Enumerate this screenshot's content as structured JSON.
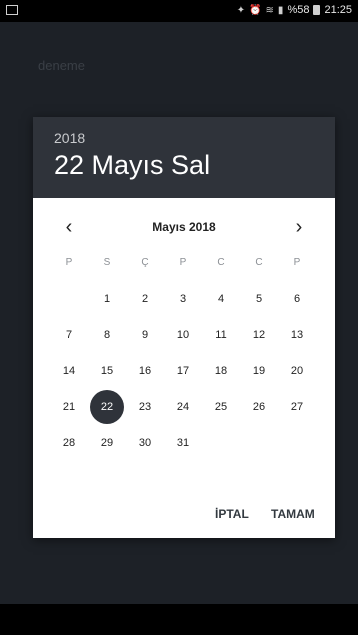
{
  "status": {
    "time": "21:25",
    "battery": "%58"
  },
  "background_field": {
    "text": "deneme"
  },
  "dialog": {
    "year": "2018",
    "date_title": "22 Mayıs Sal",
    "month_label": "Mayıs 2018",
    "weekdays": [
      "P",
      "S",
      "Ç",
      "P",
      "C",
      "C",
      "P"
    ],
    "days": [
      [
        null,
        "1",
        "2",
        "3",
        "4",
        "5",
        "6"
      ],
      [
        "7",
        "8",
        "9",
        "10",
        "11",
        "12",
        "13"
      ],
      [
        "14",
        "15",
        "16",
        "17",
        "18",
        "19",
        "20"
      ],
      [
        "21",
        "22",
        "23",
        "24",
        "25",
        "26",
        "27"
      ],
      [
        "28",
        "29",
        "30",
        "31",
        null,
        null,
        null
      ]
    ],
    "selected_day": "22",
    "cancel_label": "İPTAL",
    "ok_label": "TAMAM"
  },
  "icons": {
    "prev": "chevron-left-icon",
    "next": "chevron-right-icon"
  }
}
